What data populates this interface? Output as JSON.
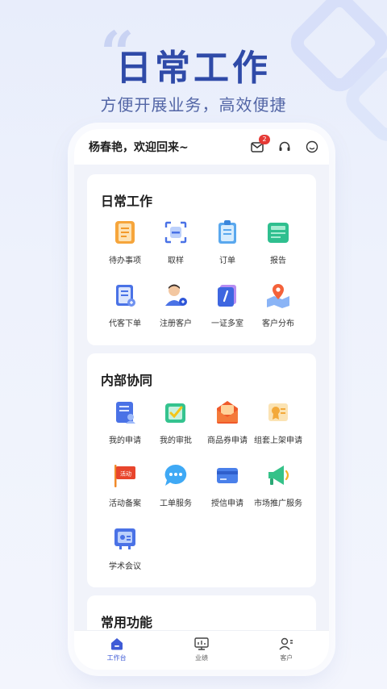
{
  "hero": {
    "title": "日常工作",
    "subtitle": "方便开展业务，高效便捷"
  },
  "topbar": {
    "greeting": "杨春艳，欢迎回来~",
    "mail_badge": "2",
    "icons": [
      "mail-icon",
      "headset-icon",
      "smiley-icon"
    ]
  },
  "sections": {
    "daily": {
      "title": "日常工作",
      "items": [
        {
          "label": "待办事项",
          "icon": "todo-icon"
        },
        {
          "label": "取样",
          "icon": "scan-icon"
        },
        {
          "label": "订单",
          "icon": "order-icon"
        },
        {
          "label": "报告",
          "icon": "report-icon"
        },
        {
          "label": "代客下单",
          "icon": "proxy-order-icon"
        },
        {
          "label": "注册客户",
          "icon": "register-customer-icon"
        },
        {
          "label": "一证多室",
          "icon": "certificate-icon"
        },
        {
          "label": "客户分布",
          "icon": "map-pin-icon"
        }
      ]
    },
    "internal": {
      "title": "内部协同",
      "items": [
        {
          "label": "我的申请",
          "icon": "application-icon"
        },
        {
          "label": "我的审批",
          "icon": "approval-icon"
        },
        {
          "label": "商品券申请",
          "icon": "coupon-icon"
        },
        {
          "label": "组套上架申请",
          "icon": "package-listing-icon"
        },
        {
          "label": "活动备案",
          "icon": "activity-flag-icon"
        },
        {
          "label": "工单服务",
          "icon": "chat-bubble-icon"
        },
        {
          "label": "授信申请",
          "icon": "card-icon"
        },
        {
          "label": "市场推广服务",
          "icon": "megaphone-icon"
        },
        {
          "label": "学术会议",
          "icon": "conference-icon"
        }
      ]
    },
    "common": {
      "title": "常用功能"
    }
  },
  "tabbar": [
    {
      "label": "工作台",
      "icon": "home-icon",
      "active": true
    },
    {
      "label": "业绩",
      "icon": "performance-icon",
      "active": false
    },
    {
      "label": "客户",
      "icon": "customers-icon",
      "active": false
    }
  ],
  "colors": {
    "accent": "#3f5bd6",
    "hero_title": "#2f4aa8",
    "badge": "#e53935"
  }
}
